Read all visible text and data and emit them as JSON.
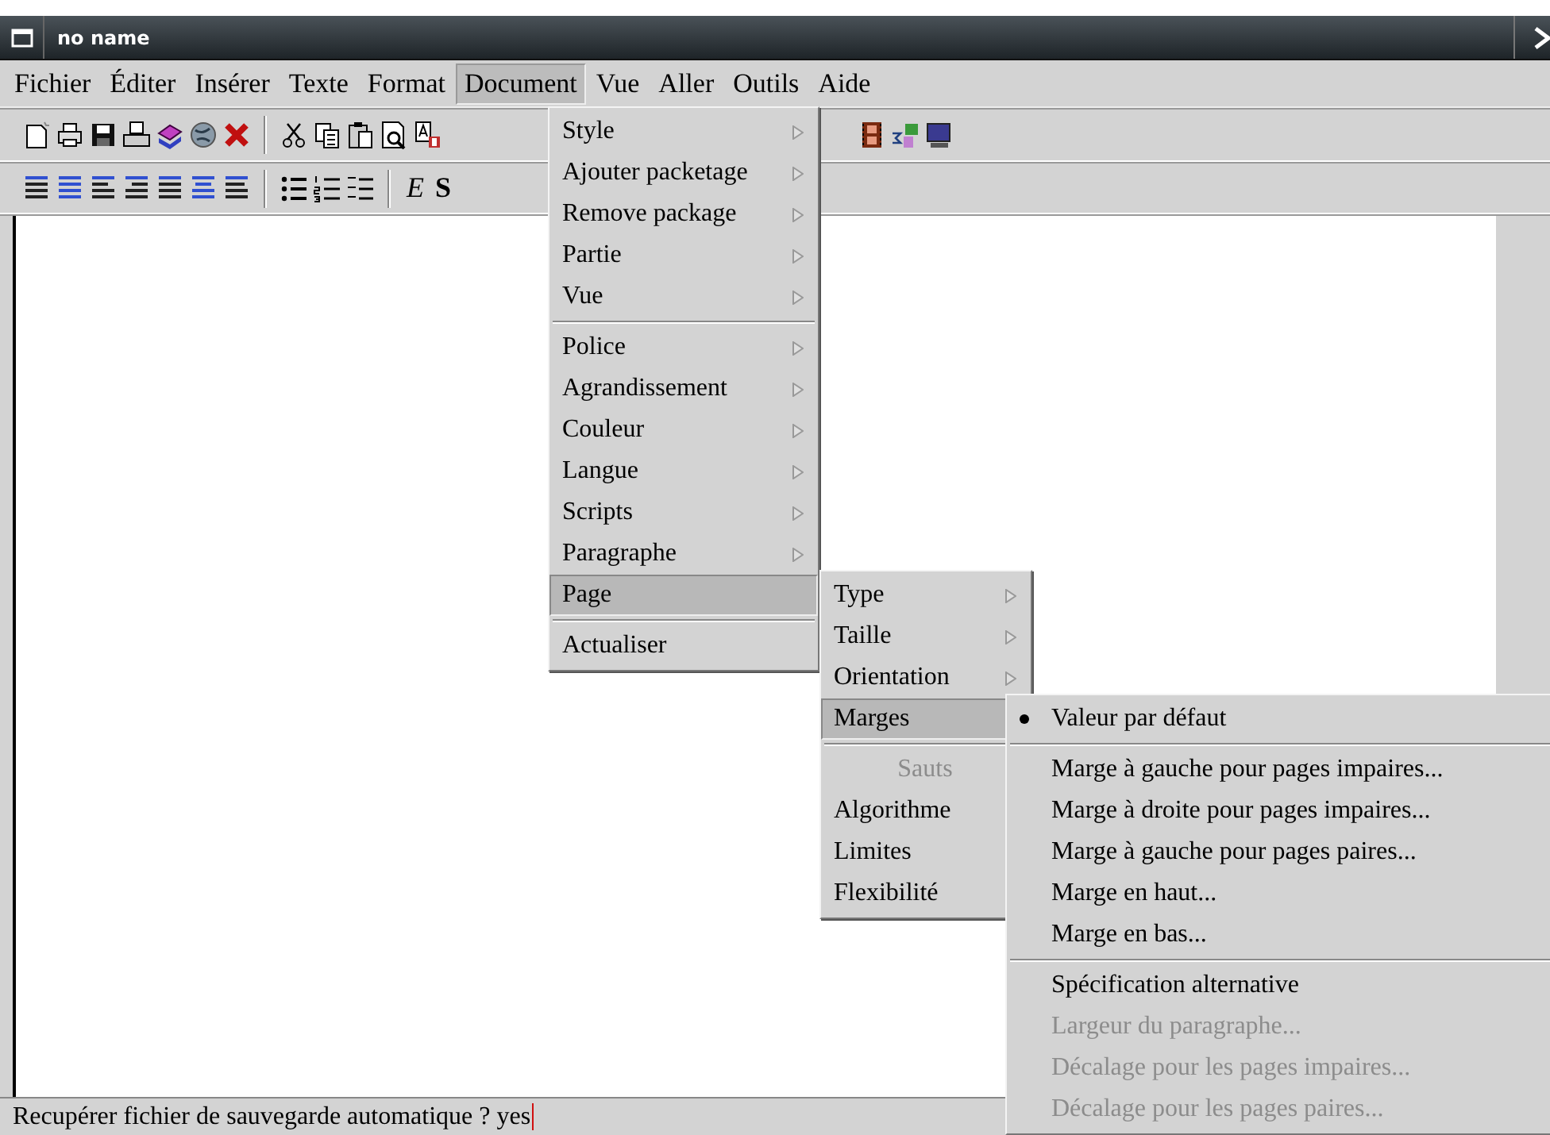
{
  "window": {
    "title": "no name"
  },
  "menubar": [
    {
      "label": "Fichier",
      "selected": false
    },
    {
      "label": "Éditer",
      "selected": false
    },
    {
      "label": "Insérer",
      "selected": false
    },
    {
      "label": "Texte",
      "selected": false
    },
    {
      "label": "Format",
      "selected": false
    },
    {
      "label": "Document",
      "selected": true
    },
    {
      "label": "Vue",
      "selected": false
    },
    {
      "label": "Aller",
      "selected": false
    },
    {
      "label": "Outils",
      "selected": false
    },
    {
      "label": "Aide",
      "selected": false
    }
  ],
  "format_toolbar": {
    "text_buttons": [
      {
        "label": "E",
        "kind": "emphasis"
      },
      {
        "label": "S",
        "kind": "bold"
      }
    ]
  },
  "open_menus": [
    {
      "items": [
        {
          "label": "Style",
          "kind": "command",
          "has_submenu": true,
          "selected": false,
          "disabled": false,
          "separator_before": false
        },
        {
          "label": "Ajouter packetage",
          "kind": "command",
          "has_submenu": true,
          "selected": false,
          "disabled": false,
          "separator_before": false
        },
        {
          "label": "Remove package",
          "kind": "command",
          "has_submenu": true,
          "selected": false,
          "disabled": false,
          "separator_before": false
        },
        {
          "label": "Partie",
          "kind": "command",
          "has_submenu": true,
          "selected": false,
          "disabled": false,
          "separator_before": false
        },
        {
          "label": "Vue",
          "kind": "command",
          "has_submenu": true,
          "selected": false,
          "disabled": false,
          "separator_before": false
        },
        {
          "label": "Police",
          "kind": "command",
          "has_submenu": true,
          "selected": false,
          "disabled": false,
          "separator_before": true
        },
        {
          "label": "Agrandissement",
          "kind": "command",
          "has_submenu": true,
          "selected": false,
          "disabled": false,
          "separator_before": false
        },
        {
          "label": "Couleur",
          "kind": "command",
          "has_submenu": true,
          "selected": false,
          "disabled": false,
          "separator_before": false
        },
        {
          "label": "Langue",
          "kind": "command",
          "has_submenu": true,
          "selected": false,
          "disabled": false,
          "separator_before": false
        },
        {
          "label": "Scripts",
          "kind": "command",
          "has_submenu": true,
          "selected": false,
          "disabled": false,
          "separator_before": false
        },
        {
          "label": "Paragraphe",
          "kind": "command",
          "has_submenu": true,
          "selected": false,
          "disabled": false,
          "separator_before": false
        },
        {
          "label": "Page",
          "kind": "command",
          "has_submenu": false,
          "selected": true,
          "disabled": false,
          "separator_before": false
        },
        {
          "label": "Actualiser",
          "kind": "command",
          "has_submenu": false,
          "selected": false,
          "disabled": false,
          "separator_before": true
        }
      ]
    },
    {
      "items": [
        {
          "label": "Type",
          "kind": "command",
          "has_submenu": true,
          "selected": false,
          "disabled": false,
          "separator_before": false
        },
        {
          "label": "Taille",
          "kind": "command",
          "has_submenu": true,
          "selected": false,
          "disabled": false,
          "separator_before": false
        },
        {
          "label": "Orientation",
          "kind": "command",
          "has_submenu": true,
          "selected": false,
          "disabled": false,
          "separator_before": false
        },
        {
          "label": "Marges",
          "kind": "command",
          "has_submenu": false,
          "selected": true,
          "disabled": false,
          "separator_before": false
        },
        {
          "label": "Sauts",
          "kind": "heading",
          "selected": false,
          "disabled": true,
          "separator_before": true
        },
        {
          "label": "Algorithme",
          "kind": "command",
          "selected": false,
          "disabled": false,
          "separator_before": false
        },
        {
          "label": "Limites",
          "kind": "command",
          "selected": false,
          "disabled": false,
          "separator_before": false
        },
        {
          "label": "Flexibilité",
          "kind": "command",
          "selected": false,
          "disabled": false,
          "separator_before": false
        }
      ]
    },
    {
      "items": [
        {
          "label": "Valeur par défaut",
          "kind": "radio",
          "checked": true,
          "selected": false,
          "disabled": false,
          "separator_before": false
        },
        {
          "label": "Marge à gauche pour pages impaires...",
          "kind": "command",
          "selected": false,
          "disabled": false,
          "separator_before": true
        },
        {
          "label": "Marge à droite pour pages impaires...",
          "kind": "command",
          "selected": false,
          "disabled": false,
          "separator_before": false
        },
        {
          "label": "Marge à gauche pour pages paires...",
          "kind": "command",
          "selected": false,
          "disabled": false,
          "separator_before": false
        },
        {
          "label": "Marge en haut...",
          "kind": "command",
          "selected": false,
          "disabled": false,
          "separator_before": false
        },
        {
          "label": "Marge en bas...",
          "kind": "command",
          "selected": false,
          "disabled": false,
          "separator_before": false
        },
        {
          "label": "Spécification alternative",
          "kind": "command",
          "selected": false,
          "disabled": false,
          "separator_before": true
        },
        {
          "label": "Largeur du paragraphe...",
          "kind": "command",
          "selected": false,
          "disabled": true,
          "separator_before": false
        },
        {
          "label": "Décalage pour les pages impaires...",
          "kind": "command",
          "selected": false,
          "disabled": true,
          "separator_before": false
        },
        {
          "label": "Décalage pour les pages paires...",
          "kind": "command",
          "selected": false,
          "disabled": true,
          "separator_before": false
        }
      ]
    }
  ],
  "status_bar": {
    "prompt": "Recupérer fichier de sauvegarde automatique ?",
    "value": "yes"
  }
}
